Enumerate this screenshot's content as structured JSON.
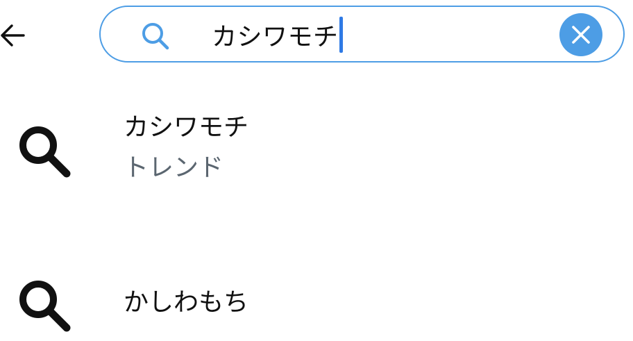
{
  "header": {
    "back_icon": "arrow-left-icon",
    "search": {
      "icon": "search-icon",
      "query": "カシワモチ",
      "clear_icon": "close-icon",
      "accent_color": "#4d9de5",
      "caret_color": "#2f7ae5"
    }
  },
  "suggestions": [
    {
      "icon": "search-icon",
      "title": "カシワモチ",
      "subtitle": "トレンド"
    },
    {
      "icon": "search-icon",
      "title": "かしわもち"
    }
  ],
  "colors": {
    "text_primary": "#111111",
    "text_secondary": "#5b6670"
  }
}
